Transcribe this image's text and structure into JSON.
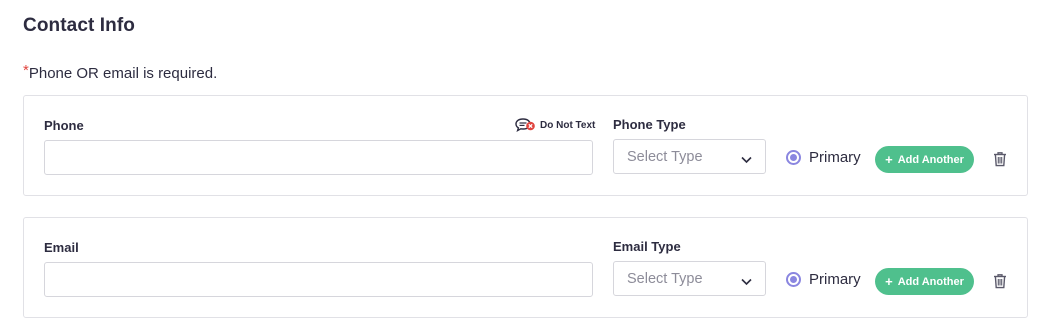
{
  "section": {
    "title": "Contact Info",
    "required_star": "*",
    "required_note": "Phone OR email is required."
  },
  "phone": {
    "label": "Phone",
    "value": "",
    "do_not_text_label": "Do Not Text",
    "type_label": "Phone Type",
    "type_placeholder": "Select Type",
    "primary_label": "Primary",
    "primary_checked": true,
    "add_another_label": "Add Another"
  },
  "email": {
    "label": "Email",
    "value": "",
    "type_label": "Email Type",
    "type_placeholder": "Select Type",
    "primary_label": "Primary",
    "primary_checked": true,
    "add_another_label": "Add Another"
  },
  "icons": {
    "do_not_text": "no-text-message-icon",
    "dropdown": "chevron-down-icon",
    "radio": "radio-selected-icon",
    "plus": "plus-icon",
    "delete": "trash-icon"
  },
  "colors": {
    "accent": "#8a86e0",
    "add_button": "#4fc08d",
    "required_star": "#e0443e",
    "text": "#2d2c40",
    "placeholder": "#8d8c99",
    "border": "#d6d6dc"
  }
}
